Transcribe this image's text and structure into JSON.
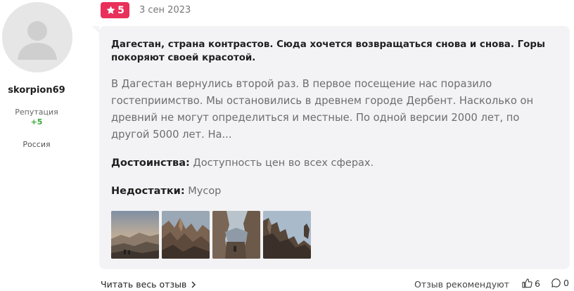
{
  "author": {
    "username": "skorpion69",
    "reputation_label": "Репутация",
    "reputation_value": "+5",
    "country": "Россия"
  },
  "review": {
    "rating": "5",
    "date": "3 сен 2023",
    "headline": "Дагестан, страна контрастов. Сюда хочется возвращаться снова и снова. Горы покоряют своей красотой.",
    "body": "В Дагестан вернулись второй раз. В первое посещение нас поразило гостеприимство. Мы остановились в древнем городе Дербент. Насколько он древний не могут определиться и местные. По одной версии 2000 лет, по другой 5000 лет. На...",
    "pros_label": "Достоинства:",
    "pros": "Доступность цен во всех сферах.",
    "cons_label": "Недостатки:",
    "cons": "Мусор",
    "photo_count": 4
  },
  "footer": {
    "read_more": "Читать весь отзыв",
    "recommend": "Отзыв рекомендуют",
    "likes": "6",
    "comments": "0"
  },
  "colors": {
    "rating_badge": "#e8305a",
    "reputation_positive": "#3aa93a",
    "card_bg": "#f3f3f5"
  },
  "icons": {
    "rating": "star-icon",
    "read_more": "chevron-right-icon",
    "likes": "thumbs-up-icon",
    "comments": "comment-icon"
  }
}
